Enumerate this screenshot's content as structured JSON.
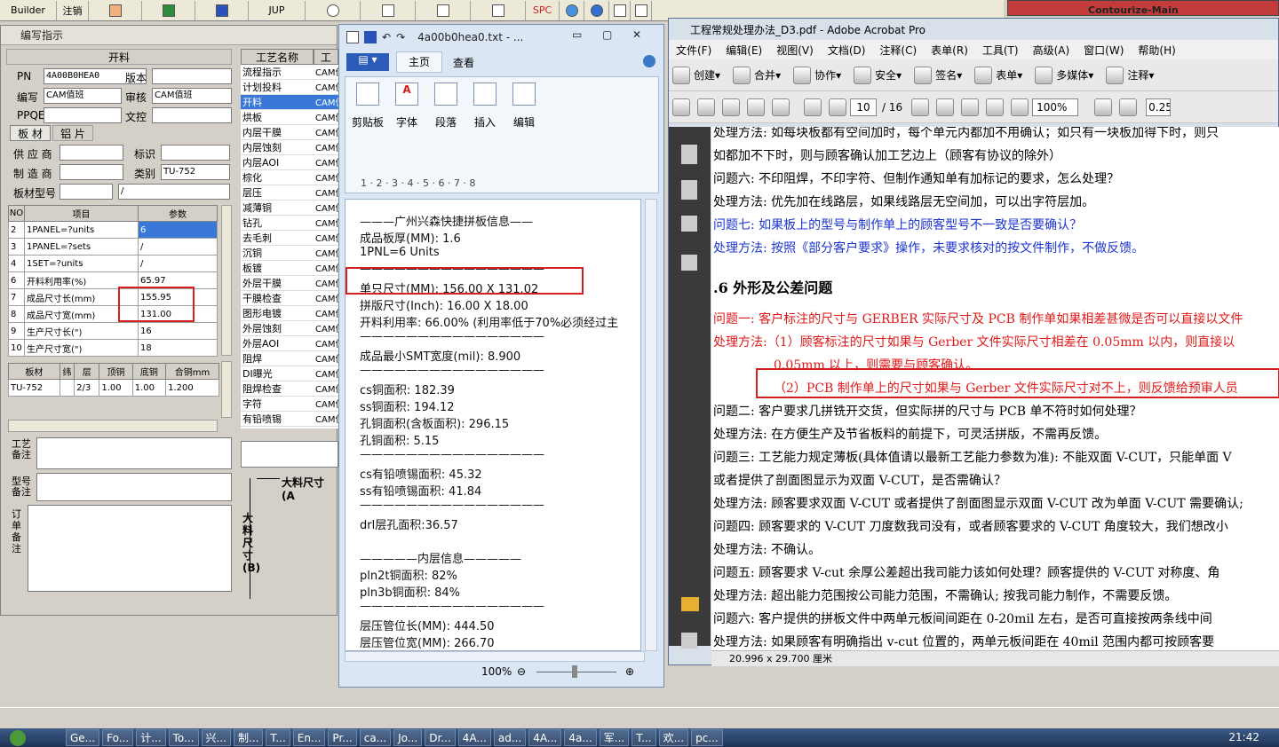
{
  "builder_toolbar": {
    "builder": "Builder",
    "annotate": "注销",
    "jup": "JUP",
    "spc": "SPC"
  },
  "top_right": {
    "line1": "...",
    "line2": "Contourize-Main"
  },
  "cam": {
    "title": "编写指示",
    "section": "开料",
    "pn_label": "PN",
    "pn_value": "4A00B0HEA0",
    "version_label": "版本",
    "writer_label": "编写",
    "writer_value": "CAM值班",
    "reviewer_label": "审核",
    "reviewer_value": "CAM值班",
    "ppqe_label": "PPQE",
    "wenkong_label": "文控",
    "tab1": "板 材",
    "tab2": "铝 片",
    "supplier_label": "供 应 商",
    "mark_label": "标识",
    "maker_label": "制 造 商",
    "category_label": "类别",
    "category_value": "TU-752",
    "board_model_label": "板材型号",
    "board_model_value": "/",
    "param_headers": [
      "NO",
      "项目",
      "参数"
    ],
    "params": [
      {
        "no": "2",
        "item": "1PANEL=?units",
        "value": "6"
      },
      {
        "no": "3",
        "item": "1PANEL=?sets",
        "value": "/"
      },
      {
        "no": "4",
        "item": "1SET=?units",
        "value": "/"
      },
      {
        "no": "6",
        "item": "开料利用率(%)",
        "value": "65.97"
      },
      {
        "no": "7",
        "item": "成品尺寸长(mm)",
        "value": "155.95"
      },
      {
        "no": "8",
        "item": "成品尺寸宽(mm)",
        "value": "131.00"
      },
      {
        "no": "9",
        "item": "生产尺寸长(\")",
        "value": "16"
      },
      {
        "no": "10",
        "item": "生产尺寸宽(\")",
        "value": "18"
      }
    ],
    "mat_headers": [
      "板材",
      "纬",
      "层",
      "顶铜",
      "底铜",
      "合铜mm"
    ],
    "mat_row": [
      "TU-752",
      "",
      "2/3",
      "1.00",
      "1.00",
      "1.200"
    ],
    "process_note_label": "工艺备注",
    "model_note_label": "型号备注",
    "order_note_label": "订单备注",
    "proc_header": [
      "工艺名称",
      "工"
    ],
    "processes": [
      "流程指示",
      "计划投料",
      "开料",
      "烘板",
      "内层干膜",
      "内层蚀刻",
      "内层AOI",
      "棕化",
      "层压",
      "减薄铜",
      "钻孔",
      "去毛刺",
      "沉铜",
      "板镀",
      "外层干膜",
      "干膜检查",
      "图形电镀",
      "外层蚀刻",
      "外层AOI",
      "阻焊",
      "DI曝光",
      "阻焊检查",
      "字符",
      "有铅喷锡"
    ],
    "proc_value": "CAM值",
    "diagram_label": "大料尺寸(A",
    "diagram_vlabel": "大料尺寸(B)"
  },
  "notepad": {
    "title": "4a00b0hea0.txt - ...",
    "tab_home": "主页",
    "tab_view": "查看",
    "groups": [
      "剪贴板",
      "字体",
      "段落",
      "插入",
      "编辑"
    ],
    "ruler": "1 · 2 · 3 · 4 · 5 · 6 · 7 · 8",
    "lines": [
      "———广州兴森快捷拼板信息——",
      "成品板厚(MM): 1.6",
      "1PNL=6 Units",
      "————————————————",
      "单只尺寸(MM): 156.00 X 131.02",
      "拼版尺寸(Inch): 16.00 X 18.00",
      "开料利用率: 66.00% (利用率低于70%必须经过主",
      "————————————————",
      "成品最小SMT宽度(mil): 8.900",
      "————————————————",
      "cs铜面积: 182.39",
      "ss铜面积: 194.12",
      "孔铜面积(含板面积): 296.15",
      "孔铜面积: 5.15",
      "————————————————",
      "cs有铅喷锡面积: 45.32",
      "ss有铅喷锡面积: 41.84",
      "————————————————",
      "drl层孔面积:36.57",
      "",
      "—————内层信息—————",
      "pln2t铜面积: 82%",
      "pln3b铜面积: 84%",
      "————————————————",
      "层压管位长(MM): 444.50",
      "层压管位宽(MM): 266.70"
    ],
    "zoom": "100%"
  },
  "acrobat": {
    "title": "工程常规处理办法_D3.pdf - Adobe Acrobat Pro",
    "menu": [
      "文件(F)",
      "编辑(E)",
      "视图(V)",
      "文档(D)",
      "注释(C)",
      "表单(R)",
      "工具(T)",
      "高级(A)",
      "窗口(W)",
      "帮助(H)"
    ],
    "toolbar": [
      "创建",
      "合并",
      "协作",
      "安全",
      "签名",
      "表单",
      "多媒体",
      "注释"
    ],
    "page_current": "10",
    "page_total": "/ 16",
    "zoom": "100%",
    "zoom2": "0.25",
    "page_size": "20.996 x 29.700 厘米",
    "lines": [
      {
        "t": "处理方法: 如每块板都有空间加时，每个单元内都加不用确认；如只有一块板加得下时，则只",
        "c": ""
      },
      {
        "t": "如都加不下时，则与顾客确认加工艺边上（顾客有协议的除外）",
        "c": ""
      },
      {
        "t": "问题六: 不印阻焊，不印字符、但制作通知单有加标记的要求，怎么处理？",
        "c": ""
      },
      {
        "t": "处理方法: 优先加在线路层，如果线路层无空间加，可以出字符层加。",
        "c": ""
      },
      {
        "t": "问题七: 如果板上的型号与制作单上的顾客型号不一致是否要确认？",
        "c": "blue"
      },
      {
        "t": "处理方法: 按照《部分客户要求》操作，未要求核对的按文件制作，不做反馈。",
        "c": "blue"
      },
      {
        "t": ".6 外形及公差问题",
        "c": "h"
      },
      {
        "t": "问题一: 客户标注的尺寸与 GERBER 实际尺寸及 PCB 制作单如果相差甚微是否可以直接以文件",
        "c": "red"
      },
      {
        "t": "处理方法:（1）顾客标注的尺寸如果与 Gerber 文件实际尺寸相差在 0.05mm 以内，则直接以",
        "c": "red"
      },
      {
        "t": "0.05mm 以上，则需要与顾客确认。",
        "c": "red"
      },
      {
        "t": "（2）PCB 制作单上的尺寸如果与 Gerber 文件实际尺寸对不上，则反馈给预审人员",
        "c": "red"
      },
      {
        "t": "问题二: 客户要求几拼铣开交货，但实际拼的尺寸与 PCB 单不符时如何处理？",
        "c": ""
      },
      {
        "t": "处理方法: 在方便生产及节省板料的前提下，可灵活拼版，不需再反馈。",
        "c": ""
      },
      {
        "t": "问题三: 工艺能力规定薄板(具体值请以最新工艺能力参数为准): 不能双面 V-CUT，只能单面 V",
        "c": ""
      },
      {
        "t": "或者提供了剖面图显示为双面 V-CUT，是否需确认？",
        "c": ""
      },
      {
        "t": "处理方法: 顾客要求双面 V-CUT 或者提供了剖面图显示双面 V-CUT 改为单面 V-CUT 需要确认;",
        "c": ""
      },
      {
        "t": "问题四: 顾客要求的 V-CUT 刀度数我司没有，或者顾客要求的 V-CUT 角度较大，我们想改小",
        "c": ""
      },
      {
        "t": "处理方法: 不确认。",
        "c": ""
      },
      {
        "t": "问题五: 顾客要求 V-cut 余厚公差超出我司能力该如何处理？顾客提供的 V-CUT 对称度、角",
        "c": ""
      },
      {
        "t": "处理方法: 超出能力范围按公司能力范围，不需确认; 按我司能力制作，不需要反馈。",
        "c": ""
      },
      {
        "t": "问题六: 客户提供的拼板文件中两单元板间间距在 0-20mil 左右，是否可直接按两条线中间",
        "c": ""
      },
      {
        "t": "处理方法: 如果顾客有明确指出 v-cut 位置的，两单元板间距在 40mil 范围内都可按顾客要",
        "c": ""
      }
    ]
  },
  "taskbar": {
    "tasks": [
      "Ge...",
      "Fo...",
      "计...",
      "To...",
      "兴...",
      "制...",
      "T...",
      "En...",
      "Pr...",
      "ca...",
      "Jo...",
      "Dr...",
      "4A...",
      "ad...",
      "4A...",
      "4a...",
      "军...",
      "T...",
      "欢...",
      "pc..."
    ],
    "time": "21:42"
  }
}
